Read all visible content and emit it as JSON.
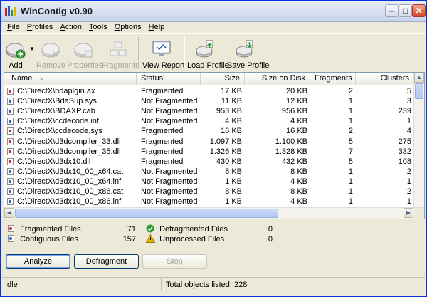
{
  "app": {
    "title": "WinContig v0.90"
  },
  "menu": [
    "File",
    "Profiles",
    "Action",
    "Tools",
    "Options",
    "Help"
  ],
  "toolbar": {
    "add": "Add",
    "remove": "Remove",
    "properties": "Properties",
    "fragments": "Fragments",
    "view_report": "View Report",
    "load_profile": "Load Profile",
    "save_profile": "Save Profile"
  },
  "list": {
    "columns": [
      "Name",
      "Status",
      "Size",
      "Size on Disk",
      "Fragments",
      "Clusters"
    ],
    "rows": [
      {
        "name": "C:\\DirectX\\bdaplgin.ax",
        "status": "Fragmented",
        "size": "17 KB",
        "disk": "20 KB",
        "frag": "2",
        "clusters": "5",
        "fragmented": true
      },
      {
        "name": "C:\\DirectX\\BdaSup.sys",
        "status": "Not Fragmented",
        "size": "11 KB",
        "disk": "12 KB",
        "frag": "1",
        "clusters": "3",
        "fragmented": false
      },
      {
        "name": "C:\\DirectX\\BDAXP.cab",
        "status": "Not Fragmented",
        "size": "953 KB",
        "disk": "956 KB",
        "frag": "1",
        "clusters": "239",
        "fragmented": false
      },
      {
        "name": "C:\\DirectX\\ccdecode.inf",
        "status": "Not Fragmented",
        "size": "4 KB",
        "disk": "4 KB",
        "frag": "1",
        "clusters": "1",
        "fragmented": false
      },
      {
        "name": "C:\\DirectX\\ccdecode.sys",
        "status": "Fragmented",
        "size": "16 KB",
        "disk": "16 KB",
        "frag": "2",
        "clusters": "4",
        "fragmented": true
      },
      {
        "name": "C:\\DirectX\\d3dcompiler_33.dll",
        "status": "Fragmented",
        "size": "1.097 KB",
        "disk": "1.100 KB",
        "frag": "5",
        "clusters": "275",
        "fragmented": true
      },
      {
        "name": "C:\\DirectX\\d3dcompiler_35.dll",
        "status": "Fragmented",
        "size": "1.326 KB",
        "disk": "1.328 KB",
        "frag": "7",
        "clusters": "332",
        "fragmented": true
      },
      {
        "name": "C:\\DirectX\\d3dx10.dll",
        "status": "Fragmented",
        "size": "430 KB",
        "disk": "432 KB",
        "frag": "5",
        "clusters": "108",
        "fragmented": true
      },
      {
        "name": "C:\\DirectX\\d3dx10_00_x64.cat",
        "status": "Not Fragmented",
        "size": "8 KB",
        "disk": "8 KB",
        "frag": "1",
        "clusters": "2",
        "fragmented": false
      },
      {
        "name": "C:\\DirectX\\d3dx10_00_x64.inf",
        "status": "Not Fragmented",
        "size": "1 KB",
        "disk": "4 KB",
        "frag": "1",
        "clusters": "1",
        "fragmented": false
      },
      {
        "name": "C:\\DirectX\\d3dx10_00_x86.cat",
        "status": "Not Fragmented",
        "size": "8 KB",
        "disk": "8 KB",
        "frag": "1",
        "clusters": "2",
        "fragmented": false
      },
      {
        "name": "C:\\DirectX\\d3dx10_00_x86.inf",
        "status": "Not Fragmented",
        "size": "1 KB",
        "disk": "4 KB",
        "frag": "1",
        "clusters": "1",
        "fragmented": false
      }
    ]
  },
  "stats": {
    "fragmented_label": "Fragmented Files",
    "fragmented_value": "71",
    "contiguous_label": "Contiguous Files",
    "contiguous_value": "157",
    "defragmented_label": "Defragmented Files",
    "defragmented_value": "0",
    "unprocessed_label": "Unprocessed Files",
    "unprocessed_value": "0"
  },
  "buttons": {
    "analyze": "Analyze",
    "defragment": "Defragment",
    "stop": "Stop"
  },
  "status": {
    "state": "Idle",
    "total": "Total objects listed: 228"
  },
  "colors": {
    "fragmented_icon": "#d42020",
    "contiguous_icon": "#2e5ebd",
    "defragmented_icon": "#2f9a32",
    "unprocessed_icon": "#e4b400"
  }
}
